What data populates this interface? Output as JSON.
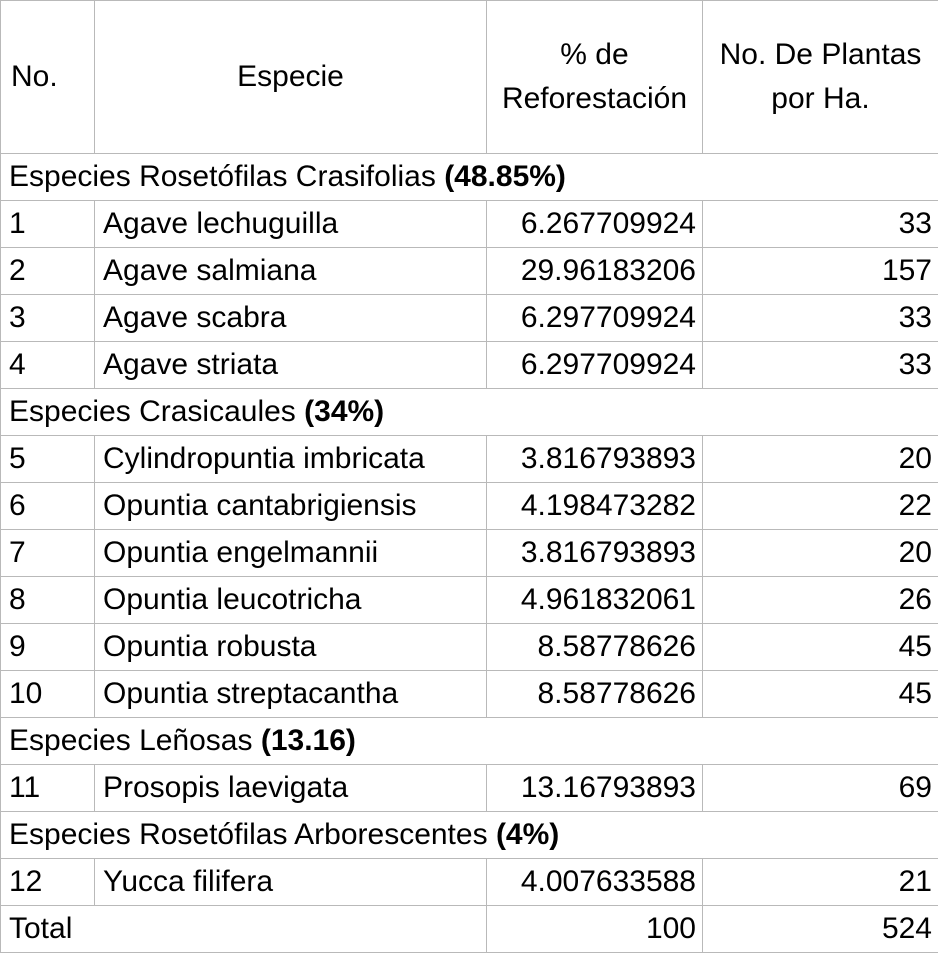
{
  "headers": {
    "no": "No.",
    "especie": "Especie",
    "reforestacion": "% de Reforestación",
    "plantas": "No. De Plantas por Ha."
  },
  "groups": [
    {
      "label": "Especies Rosetófilas Crasifolias",
      "pct": "(48.85%)",
      "rows": [
        {
          "no": "1",
          "species": "Agave lechuguilla",
          "pct": "6.267709924",
          "plants": "33"
        },
        {
          "no": "2",
          "species": "Agave salmiana",
          "pct": "29.96183206",
          "plants": "157"
        },
        {
          "no": "3",
          "species": "Agave scabra",
          "pct": "6.297709924",
          "plants": "33"
        },
        {
          "no": "4",
          "species": "Agave striata",
          "pct": "6.297709924",
          "plants": "33"
        }
      ]
    },
    {
      "label": "Especies Crasicaules",
      "pct": "(34%)",
      "rows": [
        {
          "no": "5",
          "species": "Cylindropuntia imbricata",
          "pct": "3.816793893",
          "plants": "20"
        },
        {
          "no": "6",
          "species": "Opuntia cantabrigiensis",
          "pct": "4.198473282",
          "plants": "22"
        },
        {
          "no": "7",
          "species": "Opuntia engelmannii",
          "pct": "3.816793893",
          "plants": "20"
        },
        {
          "no": "8",
          "species": "Opuntia leucotricha",
          "pct": "4.961832061",
          "plants": "26"
        },
        {
          "no": "9",
          "species": "Opuntia robusta",
          "pct": "8.58778626",
          "plants": "45"
        },
        {
          "no": "10",
          "species": "Opuntia streptacantha",
          "pct": "8.58778626",
          "plants": "45"
        }
      ]
    },
    {
      "label": "Especies Leñosas",
      "pct": "(13.16)",
      "rows": [
        {
          "no": "11",
          "species": "Prosopis laevigata",
          "pct": "13.16793893",
          "plants": "69"
        }
      ]
    },
    {
      "label": "Especies Rosetófilas Arborescentes",
      "pct": "(4%)",
      "rows": [
        {
          "no": "12",
          "species": "Yucca filifera",
          "pct": "4.007633588",
          "plants": "21"
        }
      ]
    }
  ],
  "total": {
    "label": "Total",
    "pct": "100",
    "plants": "524"
  }
}
